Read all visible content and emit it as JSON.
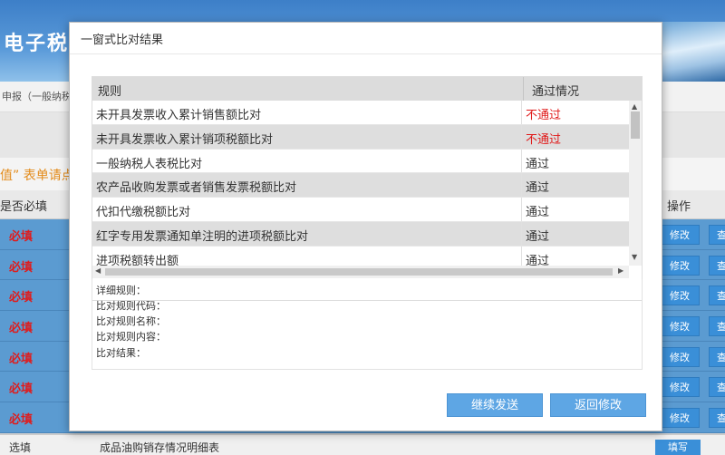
{
  "background": {
    "logo": "电子税",
    "breadcrumb": "申报（一般纳税人",
    "notice": "值” 表单请点",
    "table_header": {
      "required": "是否必填",
      "operation": "操作"
    },
    "rows": [
      {
        "required": "必填",
        "modify": "修改",
        "view": "查"
      },
      {
        "required": "必填",
        "modify": "修改",
        "view": "查"
      },
      {
        "required": "必填",
        "modify": "修改",
        "view": "查"
      },
      {
        "required": "必填",
        "modify": "修改",
        "view": "查"
      },
      {
        "required": "必填",
        "modify": "修改",
        "view": "查"
      },
      {
        "required": "必填",
        "modify": "修改",
        "view": "查"
      },
      {
        "required": "必填",
        "modify": "修改",
        "view": "查"
      }
    ],
    "last_row": {
      "required": "选填",
      "name": "成品油购销存情况明细表",
      "fill": "填写"
    }
  },
  "modal": {
    "title": "一窗式比对结果",
    "columns": {
      "rule": "规则",
      "status": "通过情况"
    },
    "rows": [
      {
        "rule": "未开具发票收入累计销售额比对",
        "status": "不通过",
        "fail": true
      },
      {
        "rule": "未开具发票收入累计销项税额比对",
        "status": "不通过",
        "fail": true
      },
      {
        "rule": "一般纳税人表税比对",
        "status": "通过",
        "fail": false
      },
      {
        "rule": "农产品收购发票或者销售发票税额比对",
        "status": "通过",
        "fail": false
      },
      {
        "rule": "代扣代缴税额比对",
        "status": "通过",
        "fail": false
      },
      {
        "rule": "红字专用发票通知单注明的进项税额比对",
        "status": "通过",
        "fail": false
      },
      {
        "rule": "进项税额转出额",
        "status": "通过",
        "fail": false
      }
    ],
    "detail": {
      "detail_rule": "详细规则：",
      "rule_code": "比对规则代码：",
      "rule_name": "比对规则名称：",
      "rule_content": "比对规则内容：",
      "result": "比对结果："
    },
    "buttons": {
      "continue": "继续发送",
      "back": "返回修改"
    }
  }
}
